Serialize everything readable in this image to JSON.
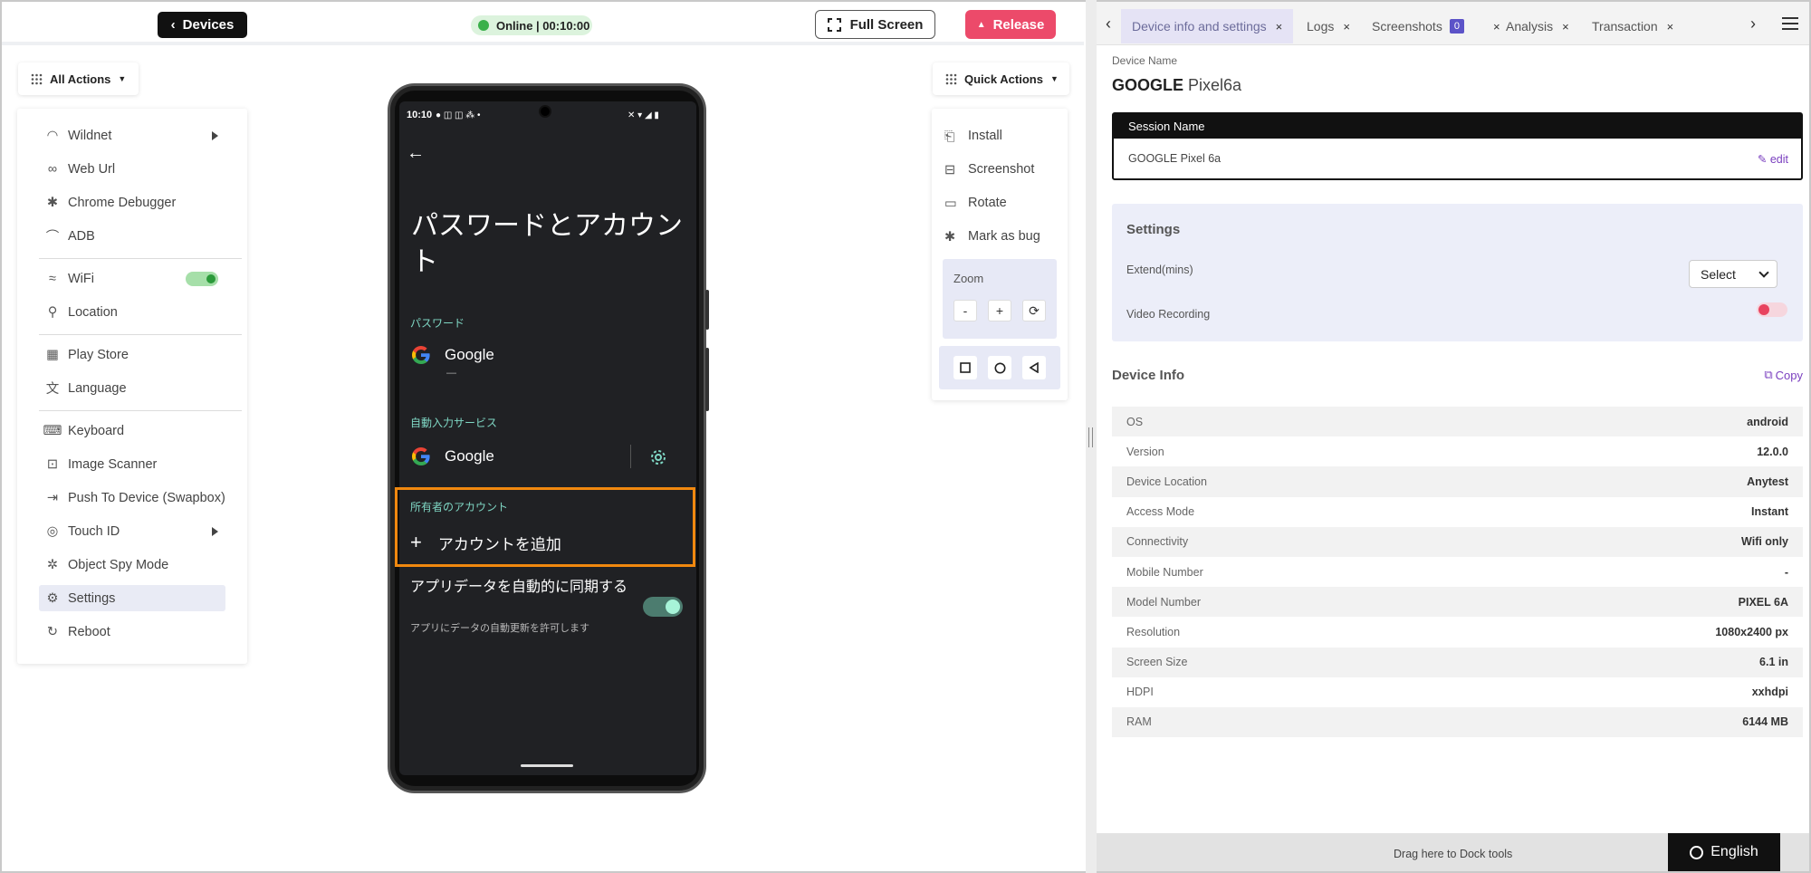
{
  "topbar": {
    "devices_label": "Devices",
    "status_text": "Online | 00:10:00",
    "fullscreen_label": "Full Screen",
    "release_label": "Release"
  },
  "left_actions": {
    "menu_label": "All Actions",
    "items": [
      {
        "label": "Wildnet",
        "icon": "wildnet-icon"
      },
      {
        "label": "Web Url",
        "icon": "link-icon"
      },
      {
        "label": "Chrome Debugger",
        "icon": "bug-icon"
      },
      {
        "label": "ADB",
        "icon": "adb-icon"
      },
      {
        "label": "WiFi",
        "icon": "wifi-icon"
      },
      {
        "label": "Location",
        "icon": "location-icon"
      },
      {
        "label": "Play Store",
        "icon": "apps-icon"
      },
      {
        "label": "Language",
        "icon": "language-icon"
      },
      {
        "label": "Keyboard",
        "icon": "keyboard-icon"
      },
      {
        "label": "Image Scanner",
        "icon": "scanner-icon"
      },
      {
        "label": "Push To Device (Swapbox)",
        "icon": "push-icon"
      },
      {
        "label": "Touch ID",
        "icon": "fingerprint-icon"
      },
      {
        "label": "Object Spy Mode",
        "icon": "spy-icon"
      },
      {
        "label": "Settings",
        "icon": "gear-icon"
      },
      {
        "label": "Reboot",
        "icon": "reboot-icon"
      }
    ]
  },
  "phone": {
    "status_time": "10:10",
    "title": "パスワードとアカウント",
    "section_passwords": "パスワード",
    "google_label": "Google",
    "google_sub": "—",
    "section_autofill": "自動入力サービス",
    "autofill_label": "Google",
    "section_owner": "所有者のアカウント",
    "add_account": "アカウントを追加",
    "sync_title": "アプリデータを自動的に同期する",
    "sync_sub": "アプリにデータの自動更新を許可します"
  },
  "quick_actions": {
    "menu_label": "Quick Actions",
    "items": [
      {
        "label": "Install",
        "icon": "install-icon"
      },
      {
        "label": "Screenshot",
        "icon": "screenshot-icon"
      },
      {
        "label": "Rotate",
        "icon": "rotate-icon"
      },
      {
        "label": "Mark as bug",
        "icon": "bug-icon"
      }
    ],
    "zoom_label": "Zoom",
    "zoom_minus": "-",
    "zoom_plus": "+"
  },
  "right_panel": {
    "tabs": [
      {
        "label": "Device info and settings",
        "active": true
      },
      {
        "label": "Logs"
      },
      {
        "label": "Screenshots",
        "badge": "0"
      },
      {
        "label": "Analysis"
      },
      {
        "label": "Transaction"
      }
    ],
    "device_name_label": "Device Name",
    "device_brand": "GOOGLE",
    "device_model": "Pixel6a",
    "session_header": "Session Name",
    "session_value": "GOOGLE Pixel 6a",
    "session_edit": "edit",
    "settings_title": "Settings",
    "extend_label": "Extend(mins)",
    "extend_select": "Select",
    "video_label": "Video Recording",
    "device_info_title": "Device Info",
    "copy_label": "Copy",
    "device_info": [
      {
        "key": "OS",
        "value": "android"
      },
      {
        "key": "Version",
        "value": "12.0.0"
      },
      {
        "key": "Device Location",
        "value": "Anytest"
      },
      {
        "key": "Access Mode",
        "value": "Instant"
      },
      {
        "key": "Connectivity",
        "value": "Wifi only"
      },
      {
        "key": "Mobile Number",
        "value": "-"
      },
      {
        "key": "Model Number",
        "value": "PIXEL 6A"
      },
      {
        "key": "Resolution",
        "value": "1080x2400 px"
      },
      {
        "key": "Screen Size",
        "value": "6.1 in"
      },
      {
        "key": "HDPI",
        "value": "xxhdpi"
      },
      {
        "key": "RAM",
        "value": "6144 MB"
      }
    ],
    "dock_text": "Drag here to Dock tools",
    "language": "English"
  },
  "colors": {
    "release": "#ec4a6a",
    "online": "#3ab04a",
    "accent": "#7a3fbf",
    "highlight": "#f0880f"
  }
}
